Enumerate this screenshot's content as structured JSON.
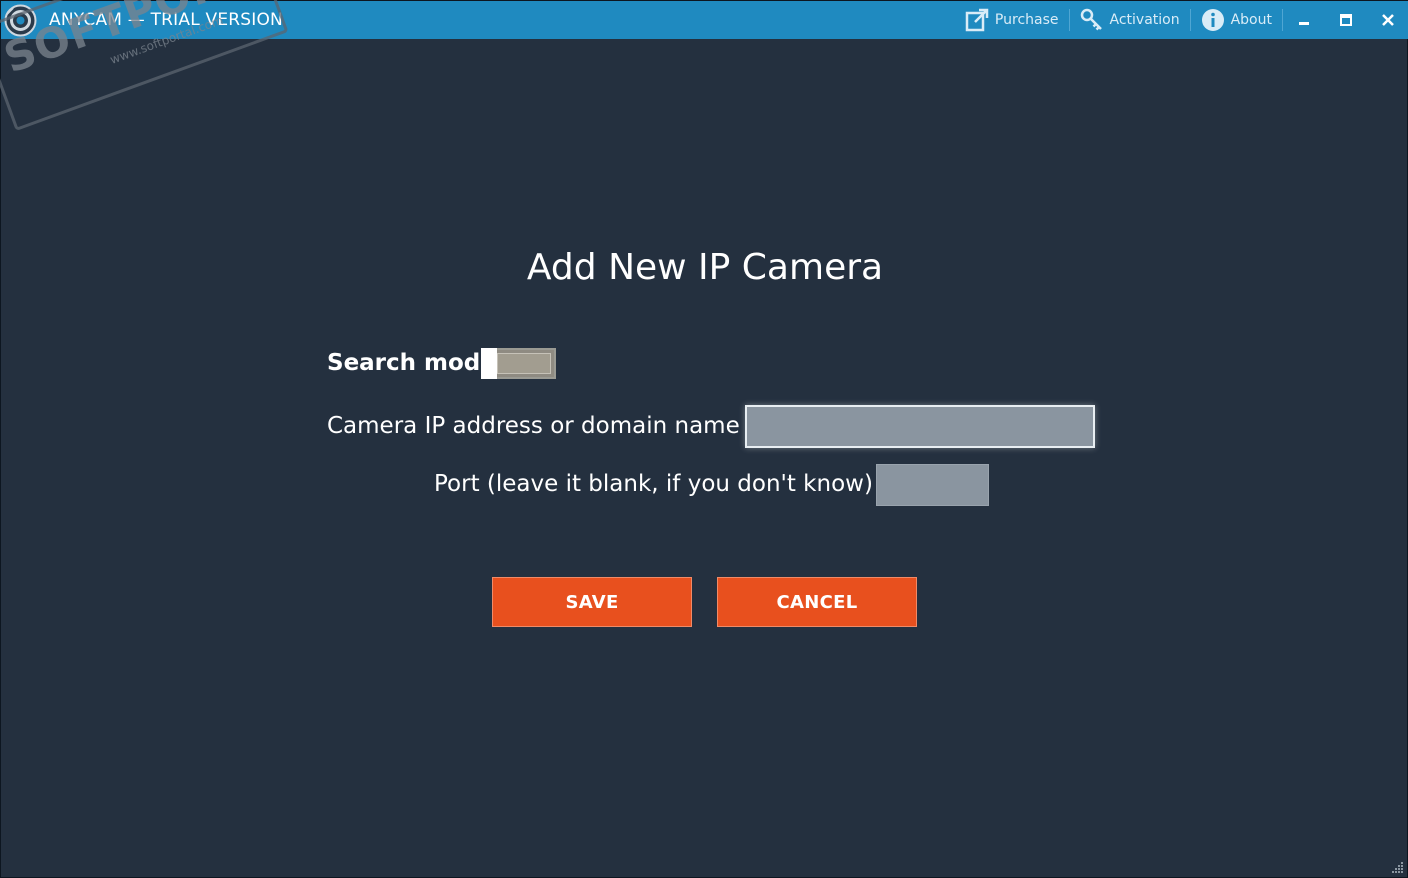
{
  "titlebar": {
    "app_title": "ANYCAM — TRIAL VERSION",
    "links": {
      "purchase": "Purchase",
      "activation": "Activation",
      "about": "About"
    },
    "icons": {
      "purchase": "external-link-icon",
      "activation": "key-icon",
      "about": "info-icon",
      "minimize": "minimize-icon",
      "maximize": "maximize-icon",
      "close": "close-icon"
    }
  },
  "watermark": {
    "brand": "SOFTPORTAL",
    "url": "www.softportal.com"
  },
  "dialog": {
    "title": "Add New IP Camera",
    "search_mode_label": "Search mode",
    "search_mode_on": false,
    "ip_label": "Camera IP address or domain name",
    "ip_value": "",
    "port_label": "Port (leave it blank, if you don't know)",
    "port_value": "",
    "save_label": "SAVE",
    "cancel_label": "CANCEL"
  },
  "colors": {
    "titlebar_bg": "#1f8ac0",
    "body_bg": "#24303f",
    "button_bg": "#e8501e",
    "input_bg": "#8a95a0"
  }
}
